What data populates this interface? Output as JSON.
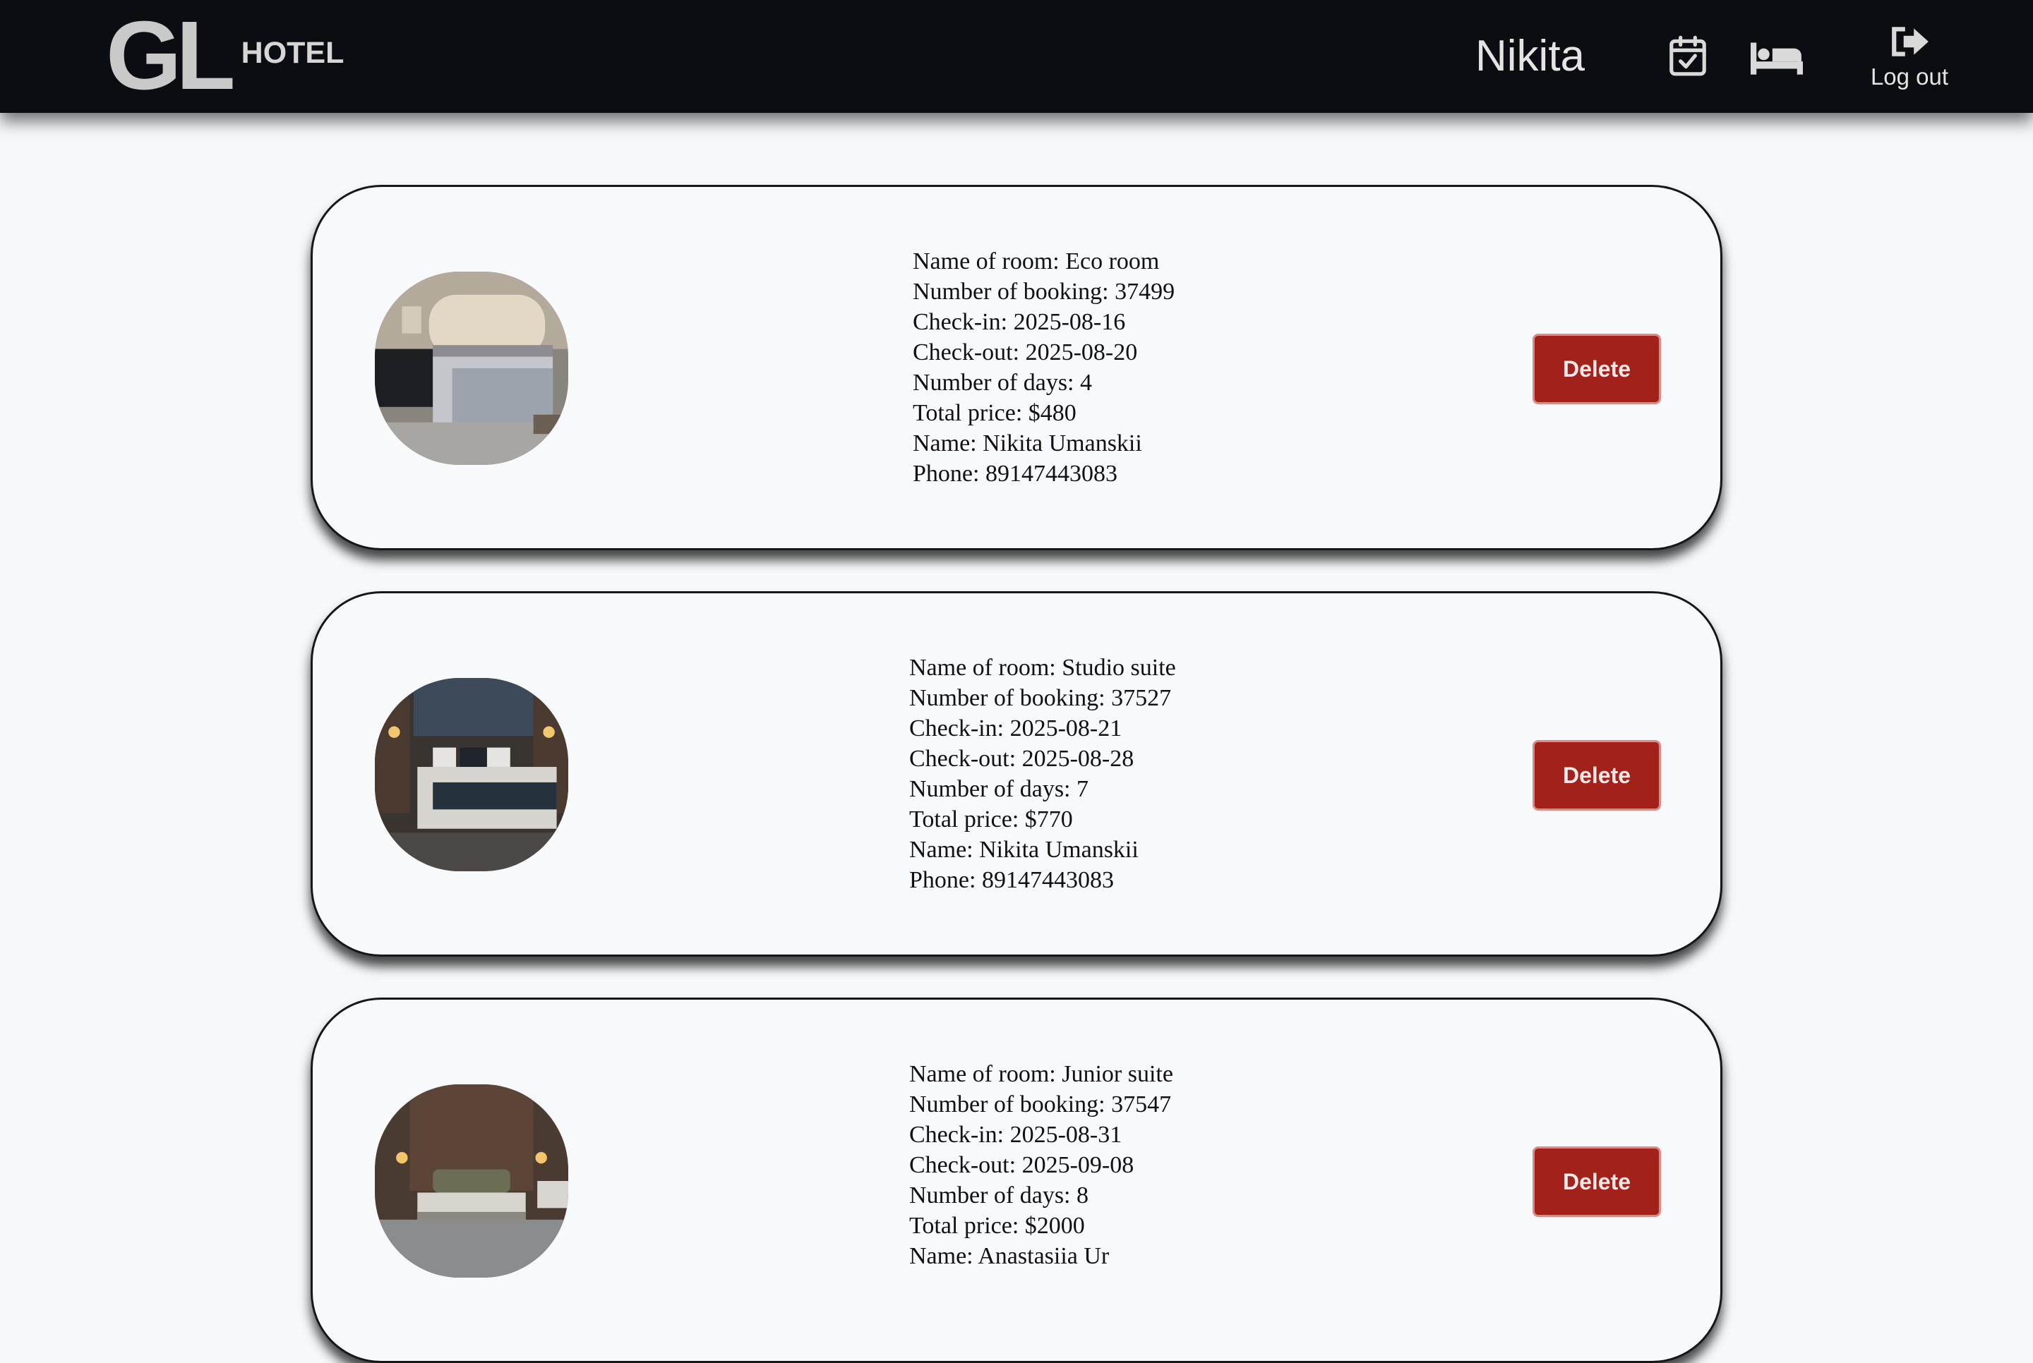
{
  "header": {
    "logo_main": "GL",
    "logo_sub": "HOTEL",
    "user_name": "Nikita",
    "logout_label": "Log out",
    "icons": [
      "calendar-check-icon",
      "bed-icon",
      "logout-icon"
    ]
  },
  "bookings": [
    {
      "photo": "eco-room-photo",
      "room": "Name of room: Eco room",
      "booking_number": "Number of booking: 37499",
      "check_in": "Check-in: 2025-08-16",
      "check_out": "Check-out: 2025-08-20",
      "days": "Number of days: 4",
      "total": "Total price: $480",
      "name": "Name: Nikita Umanskii",
      "phone": "Phone: 89147443083",
      "delete_label": "Delete"
    },
    {
      "photo": "studio-suite-photo",
      "room": "Name of room: Studio suite",
      "booking_number": "Number of booking: 37527",
      "check_in": "Check-in: 2025-08-21",
      "check_out": "Check-out: 2025-08-28",
      "days": "Number of days: 7",
      "total": "Total price: $770",
      "name": "Name: Nikita Umanskii",
      "phone": "Phone: 89147443083",
      "delete_label": "Delete"
    },
    {
      "photo": "junior-suite-photo",
      "room": "Name of room: Junior suite",
      "booking_number": "Number of booking: 37547",
      "check_in": "Check-in: 2025-08-31",
      "check_out": "Check-out: 2025-09-08",
      "days": "Number of days: 8",
      "total": "Total price: $2000",
      "name": "Name: Anastasiia Ur",
      "phone": "",
      "delete_label": "Delete"
    }
  ],
  "colors": {
    "header_bg": "#0b0d12",
    "page_bg": "#f6f8fa",
    "delete_bg": "#a2211a"
  }
}
